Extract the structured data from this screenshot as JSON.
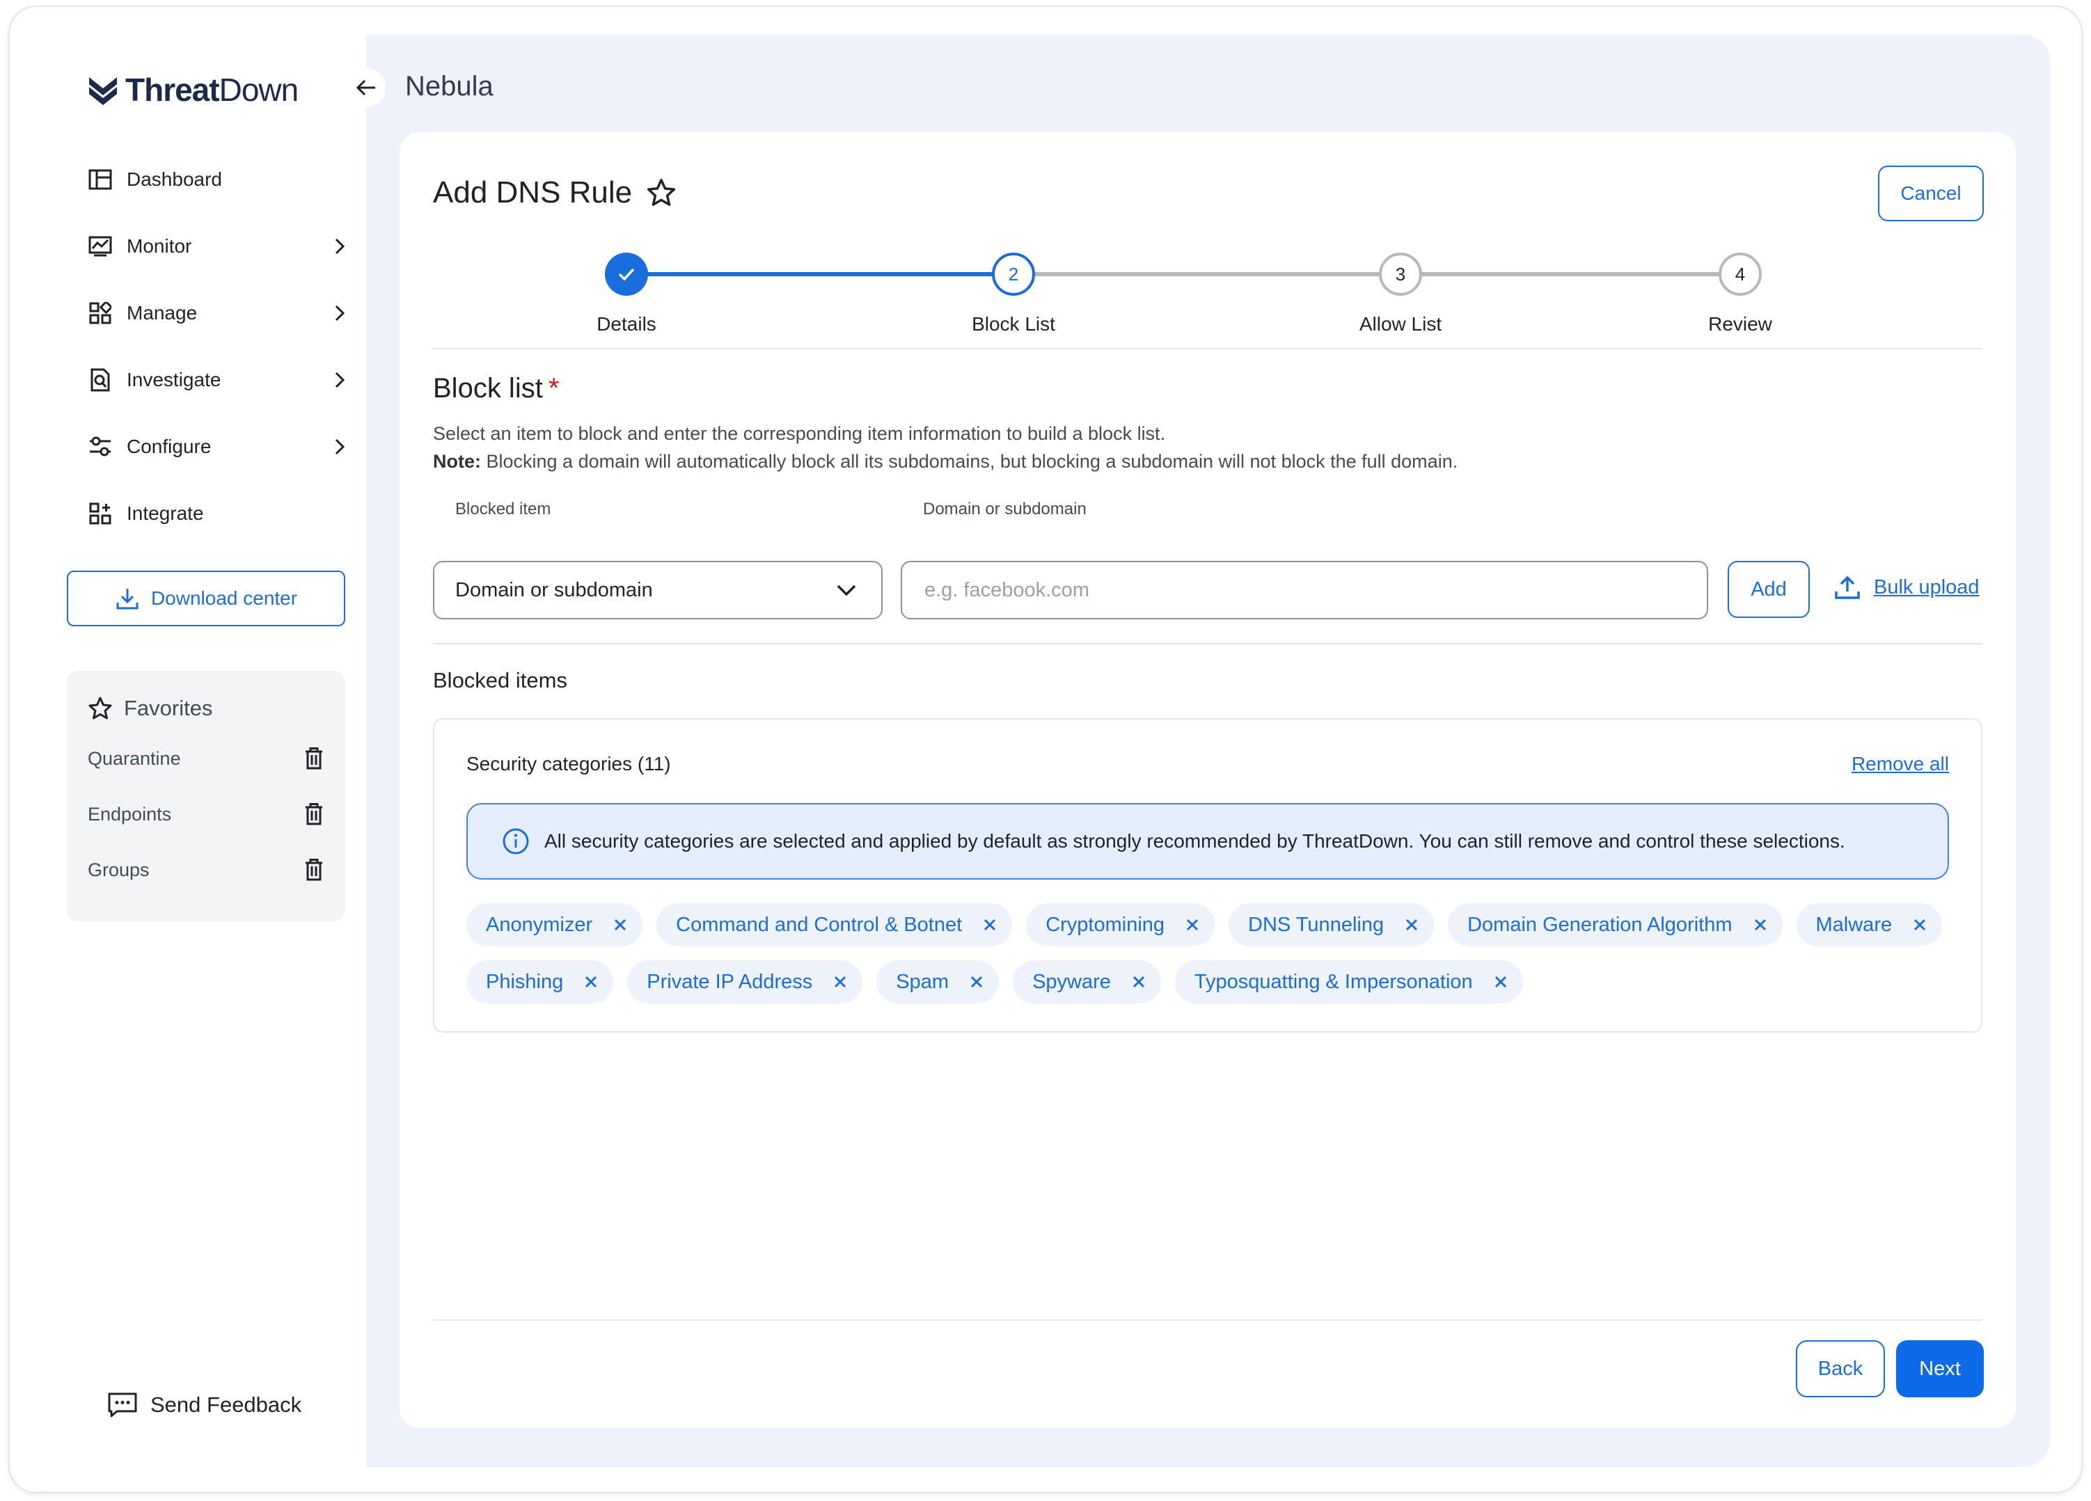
{
  "brand": {
    "name_bold": "Threat",
    "name_rest": "Down"
  },
  "sidebar": {
    "items": [
      {
        "label": "Dashboard",
        "icon": "dashboard-icon",
        "chevron": false
      },
      {
        "label": "Monitor",
        "icon": "monitor-icon",
        "chevron": true
      },
      {
        "label": "Manage",
        "icon": "manage-icon",
        "chevron": true
      },
      {
        "label": "Investigate",
        "icon": "investigate-icon",
        "chevron": true
      },
      {
        "label": "Configure",
        "icon": "configure-icon",
        "chevron": true
      },
      {
        "label": "Integrate",
        "icon": "integrate-icon",
        "chevron": false
      }
    ],
    "download_label": "Download center",
    "favorites": {
      "title": "Favorites",
      "items": [
        "Quarantine",
        "Endpoints",
        "Groups"
      ]
    },
    "feedback_label": "Send Feedback"
  },
  "header": {
    "breadcrumb": "Nebula"
  },
  "page": {
    "title": "Add DNS Rule",
    "cancel_label": "Cancel",
    "steps": [
      {
        "number": "1",
        "label": "Details",
        "state": "complete"
      },
      {
        "number": "2",
        "label": "Block List",
        "state": "active"
      },
      {
        "number": "3",
        "label": "Allow List",
        "state": "pending"
      },
      {
        "number": "4",
        "label": "Review",
        "state": "pending"
      }
    ],
    "section_title": "Block list",
    "required_mark": "*",
    "description": "Select an item to block and enter the corresponding item information to build a block list.",
    "note_label": "Note:",
    "note_text": " Blocking a domain will automatically block all its subdomains, but blocking a subdomain will not block the full domain.",
    "blocked_item_label": "Blocked item",
    "blocked_item_value": "Domain or subdomain",
    "domain_label": "Domain or subdomain",
    "domain_value": "",
    "domain_placeholder": "e.g. facebook.com",
    "add_label": "Add",
    "bulk_upload_label": "Bulk upload",
    "blocked_items_title": "Blocked items",
    "categories_header": "Security categories (11)",
    "remove_all_label": "Remove all",
    "info_text": "All security categories are selected and applied by default as strongly recommended by ThreatDown. You can still remove and control these selections.",
    "chip_rows": [
      [
        "Anonymizer",
        "Command and Control & Botnet",
        "Cryptomining",
        "DNS Tunneling",
        "Domain Generation Algorithm",
        "Malware"
      ],
      [
        "Phishing",
        "Private IP Address",
        "Spam",
        "Spyware",
        "Typosquatting & Impersonation"
      ]
    ],
    "back_label": "Back",
    "next_label": "Next"
  },
  "colors": {
    "accent": "#1a6ddc",
    "primary_button": "#0d6bea",
    "main_bg": "#eef3fb",
    "info_bg": "#e3edfb",
    "required": "#d21c1c",
    "step_pending": "#b5b9bf"
  }
}
